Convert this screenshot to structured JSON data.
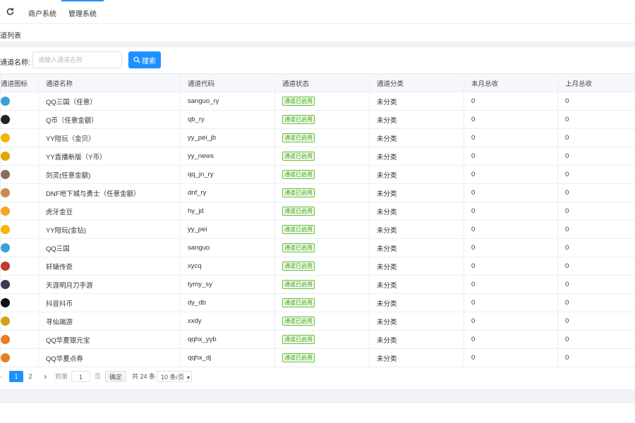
{
  "topnav": {
    "tabs": [
      "商户系统",
      "管理系统"
    ]
  },
  "breadcrumb": {
    "title": "道列表"
  },
  "search": {
    "label": "通道名称:",
    "placeholder": "请输入通道名称",
    "button": "搜索"
  },
  "table": {
    "headers": [
      "通道图标",
      "通道名称",
      "通道代码",
      "通道状态",
      "通道分类",
      "本月总收",
      "上月总收"
    ],
    "rows": [
      {
        "name": "QQ三国（任意）",
        "code": "sanguo_ry",
        "status": "通道已启用",
        "category": "未分类",
        "this_month": "0",
        "last_month": "0",
        "icon": "sanguo-icon",
        "color": "#3aa0d8"
      },
      {
        "name": "Q币（任意金额）",
        "code": "qb_ry",
        "status": "通道已启用",
        "category": "未分类",
        "this_month": "0",
        "last_month": "0",
        "icon": "qbi-icon",
        "color": "#222222"
      },
      {
        "name": "YY陪玩（金贝）",
        "code": "yy_pei_jb",
        "status": "通道已启用",
        "category": "未分类",
        "this_month": "0",
        "last_month": "0",
        "icon": "yy-icon",
        "color": "#f2b705"
      },
      {
        "name": "YY直播新版（Y币）",
        "code": "yy_news",
        "status": "通道已启用",
        "category": "未分类",
        "this_month": "0",
        "last_month": "0",
        "icon": "yy-news-icon",
        "color": "#e0a800"
      },
      {
        "name": "剑灵(任意金额)",
        "code": "qq_jn_ry",
        "status": "通道已启用",
        "category": "未分类",
        "this_month": "0",
        "last_month": "0",
        "icon": "jianling-icon",
        "color": "#8a6d5a"
      },
      {
        "name": "DNF地下城与勇士（任意金额）",
        "code": "dnf_ry",
        "status": "通道已启用",
        "category": "未分类",
        "this_month": "0",
        "last_month": "0",
        "icon": "dnf-icon",
        "color": "#c98a4b"
      },
      {
        "name": "虎牙金豆",
        "code": "hy_jd",
        "status": "通道已启用",
        "category": "未分类",
        "this_month": "0",
        "last_month": "0",
        "icon": "huya-icon",
        "color": "#f5a623"
      },
      {
        "name": "YY陪玩(金钻)",
        "code": "yy_pei",
        "status": "通道已启用",
        "category": "未分类",
        "this_month": "0",
        "last_month": "0",
        "icon": "yy-pei-icon",
        "color": "#f2b705"
      },
      {
        "name": "QQ三国",
        "code": "sanguo",
        "status": "通道已启用",
        "category": "未分类",
        "this_month": "0",
        "last_month": "0",
        "icon": "sanguo-icon",
        "color": "#3aa0d8"
      },
      {
        "name": "轩辕传奇",
        "code": "xycq",
        "status": "通道已启用",
        "category": "未分类",
        "this_month": "0",
        "last_month": "0",
        "icon": "xuanyuan-icon",
        "color": "#c0392b"
      },
      {
        "name": "天涯明月刀手游",
        "code": "tymy_sy",
        "status": "通道已启用",
        "category": "未分类",
        "this_month": "0",
        "last_month": "0",
        "icon": "tianya-icon",
        "color": "#3b3b4f"
      },
      {
        "name": "抖音抖币",
        "code": "dy_db",
        "status": "通道已启用",
        "category": "未分类",
        "this_month": "0",
        "last_month": "0",
        "icon": "douyin-icon",
        "color": "#111111"
      },
      {
        "name": "寻仙端游",
        "code": "xxdy",
        "status": "通道已启用",
        "category": "未分类",
        "this_month": "0",
        "last_month": "0",
        "icon": "xunxian-icon",
        "color": "#d4a017"
      },
      {
        "name": "QQ华夏银元宝",
        "code": "qqhx_yyb",
        "status": "通道已启用",
        "category": "未分类",
        "this_month": "0",
        "last_month": "0",
        "icon": "huaxia-icon",
        "color": "#e67e22"
      },
      {
        "name": "QQ华夏点券",
        "code": "qqhx_dj",
        "status": "通道已启用",
        "category": "未分类",
        "this_month": "0",
        "last_month": "0",
        "icon": "huaxia-dj-icon",
        "color": "#e67e22"
      }
    ]
  },
  "pagination": {
    "pages": [
      "1",
      "2"
    ],
    "current": "1",
    "goto_label": "到第",
    "goto_value": "1",
    "page_unit": "页",
    "confirm": "确定",
    "total": "共 24 条",
    "page_size": "10 条/页"
  }
}
